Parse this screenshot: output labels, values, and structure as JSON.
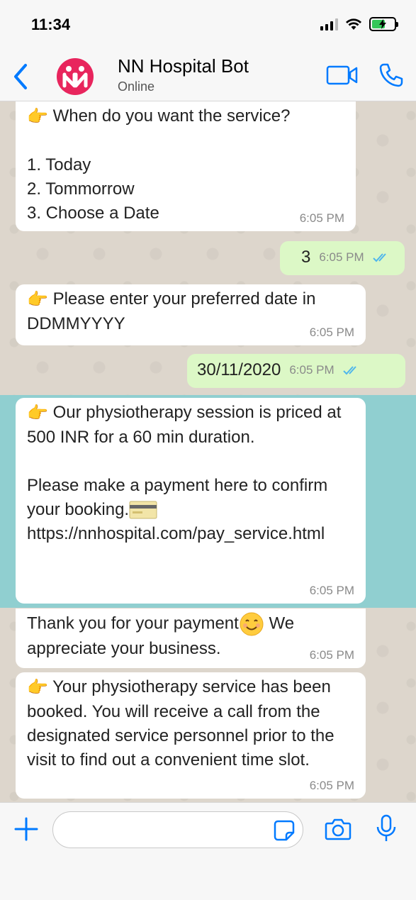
{
  "status_bar": {
    "time": "11:34"
  },
  "header": {
    "contact_name": "NN Hospital Bot",
    "contact_status": "Online"
  },
  "messages": [
    {
      "dir": "in",
      "text": "When do you want the service?\n\n1. Today\n2. Tommorrow\n3. Choose a Date",
      "time": "6:05 PM",
      "pointer": true
    },
    {
      "dir": "out",
      "text": "3",
      "time": "6:05 PM"
    },
    {
      "dir": "in",
      "text": "Please enter your preferred date in DDMMYYYY",
      "time": "6:05 PM",
      "pointer": true
    },
    {
      "dir": "out",
      "text": "30/11/2020",
      "time": "6:05 PM"
    },
    {
      "dir": "in",
      "text": "Our physiotherapy session is priced at 500 INR for a 60 min duration.\n\nPlease make a payment here to confirm your booking.",
      "link": "https://nnhospital.com/pay_service.html",
      "time": "6:05 PM",
      "pointer": true,
      "emoji": "credit-card"
    },
    {
      "dir": "in",
      "text_before": "Thank you for your payment",
      "text_after": " We appreciate your business.",
      "time": "6:05 PM",
      "emoji": "smiling-face"
    },
    {
      "dir": "in",
      "text": "Your physiotherapy service has been booked. You will receive a call from the designated service personnel prior to the visit to find out a convenient time slot.",
      "time": "6:05 PM",
      "pointer": true
    }
  ],
  "input": {
    "placeholder": ""
  },
  "colors": {
    "accent": "#007aff",
    "avatar": "#e8255d",
    "outgoing_bubble": "#dcf8c6",
    "incoming_bubble": "#ffffff",
    "highlight": "#90cfd0",
    "read_ticks": "#4fb6ec"
  }
}
